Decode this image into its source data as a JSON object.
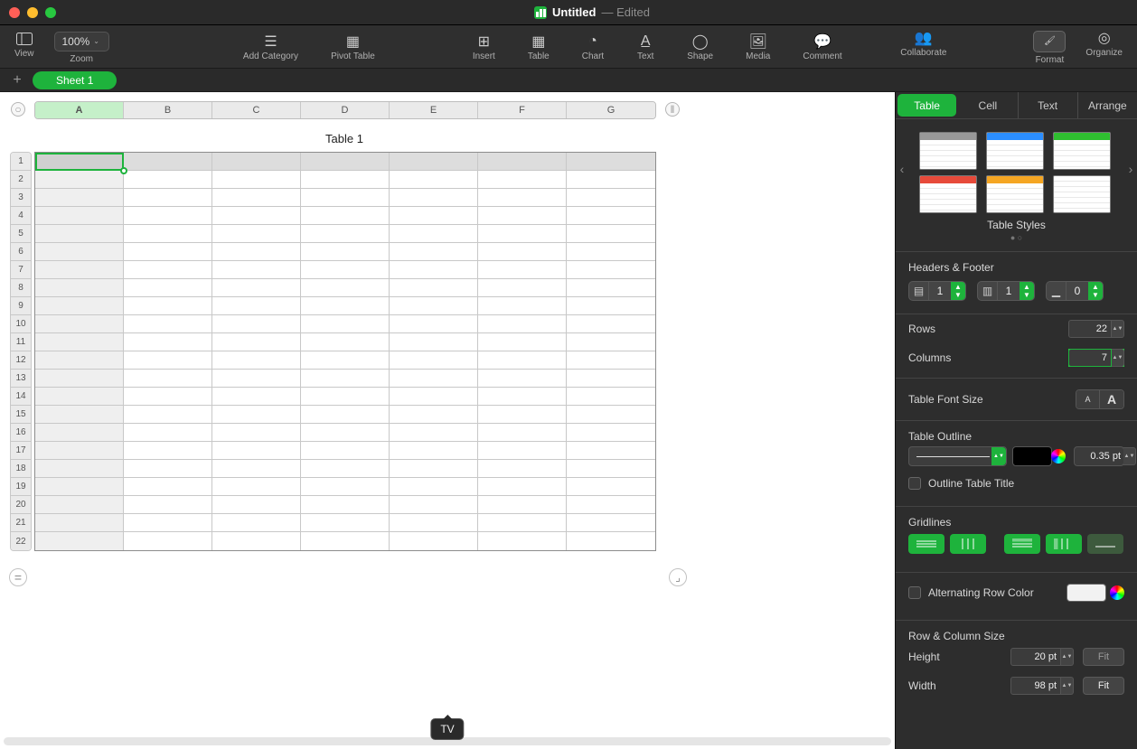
{
  "window": {
    "title": "Untitled",
    "status": "Edited"
  },
  "toolbar": {
    "view": "View",
    "zoom": "Zoom",
    "zoom_value": "100%",
    "add_category": "Add Category",
    "pivot": "Pivot Table",
    "insert": "Insert",
    "table": "Table",
    "chart": "Chart",
    "text": "Text",
    "shape": "Shape",
    "media": "Media",
    "comment": "Comment",
    "collaborate": "Collaborate",
    "format": "Format",
    "organize": "Organize"
  },
  "sheets": {
    "tab1": "Sheet 1"
  },
  "spreadsheet": {
    "title": "Table 1",
    "columns": [
      "A",
      "B",
      "C",
      "D",
      "E",
      "F",
      "G"
    ],
    "rows_count": 22
  },
  "sidepanel": {
    "tabs": {
      "table": "Table",
      "cell": "Cell",
      "text": "Text",
      "arrange": "Arrange"
    },
    "styles_label": "Table Styles",
    "headers_footer": "Headers & Footer",
    "header_rows": "1",
    "header_cols": "1",
    "footer_rows": "0",
    "rows_label": "Rows",
    "rows_value": "22",
    "cols_label": "Columns",
    "cols_value": "7",
    "font_size_label": "Table Font Size",
    "outline_label": "Table Outline",
    "outline_pt": "0.35 pt",
    "outline_title_label": "Outline Table Title",
    "gridlines_label": "Gridlines",
    "alt_row_label": "Alternating Row Color",
    "size_label": "Row & Column Size",
    "height_label": "Height",
    "height_value": "20 pt",
    "width_label": "Width",
    "width_value": "98 pt",
    "fit": "Fit"
  },
  "tooltip": "TV"
}
